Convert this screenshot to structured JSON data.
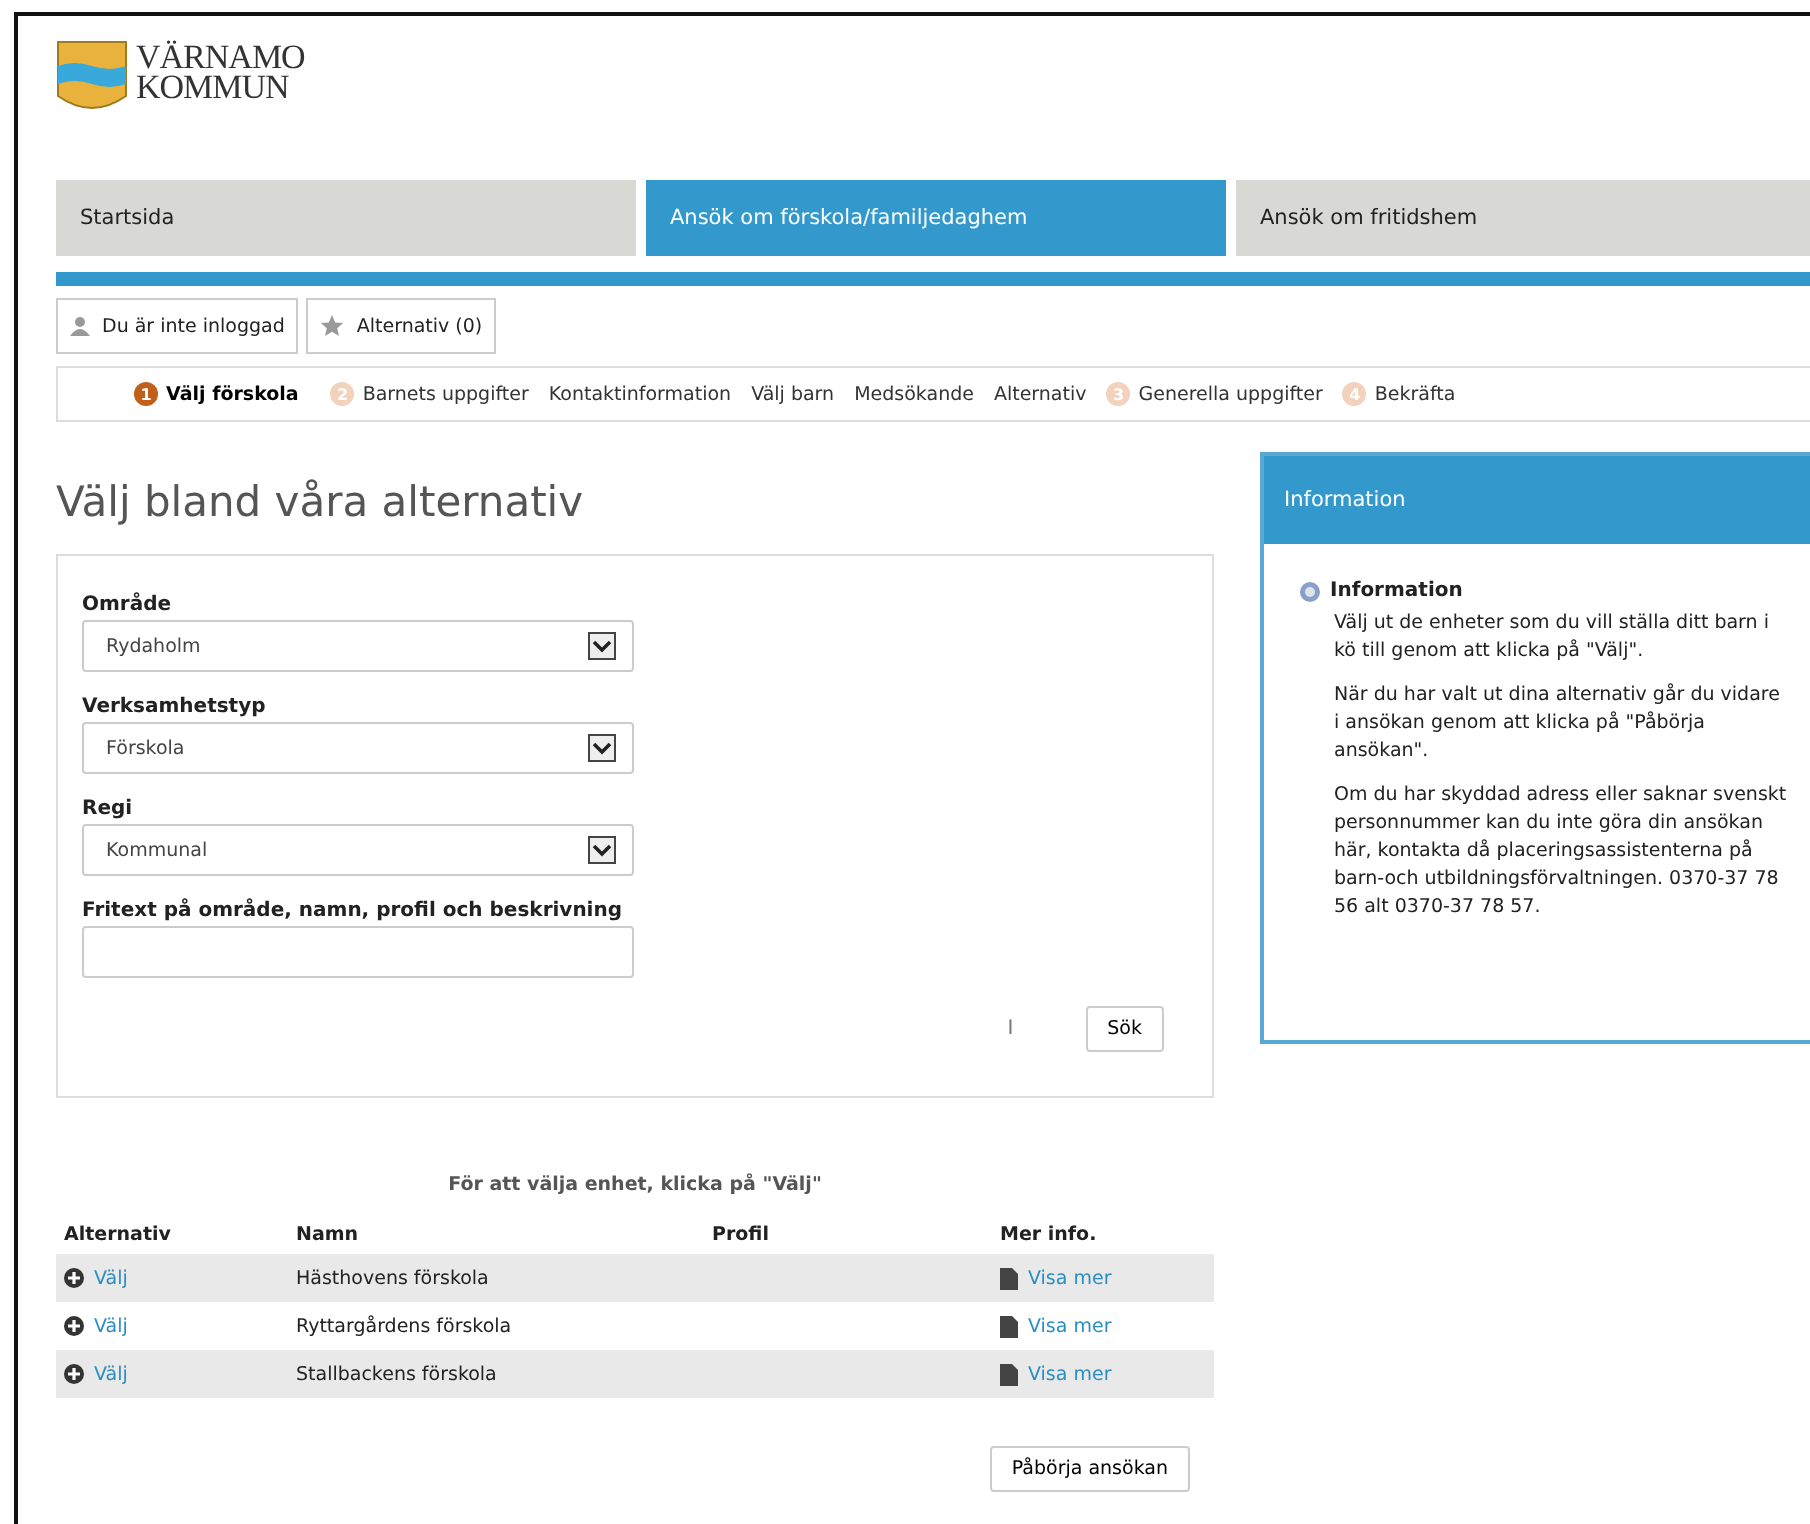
{
  "logo": {
    "line_1": "VÄRNAMO",
    "line_2": "KOMMUN"
  },
  "nav_tabs": [
    {
      "label": "Startsida",
      "selected": false
    },
    {
      "label": "Ansök om förskola/familjedaghem",
      "selected": true
    },
    {
      "label": "Ansök om fritidshem",
      "selected": false
    }
  ],
  "user_bar": [
    {
      "kind": "user",
      "label": "Du är inte inloggad"
    },
    {
      "kind": "star",
      "label": "Alternativ (0)"
    }
  ],
  "steps": [
    {
      "kind": "numbered",
      "number": "1",
      "label": "Välj förskola",
      "selected": true
    },
    {
      "kind": "numbered",
      "number": "2",
      "label": "Barnets uppgifter",
      "selected": false
    },
    {
      "kind": "plain",
      "label": "Kontaktinformation",
      "selected": false
    },
    {
      "kind": "plain",
      "label": "Välj barn",
      "selected": false
    },
    {
      "kind": "plain",
      "label": "Medsökande",
      "selected": false
    },
    {
      "kind": "plain",
      "label": "Alternativ",
      "selected": false
    },
    {
      "kind": "numbered",
      "number": "3",
      "label": "Generella uppgifter",
      "selected": false
    },
    {
      "kind": "numbered",
      "number": "4",
      "label": "Bekräfta",
      "selected": false
    }
  ],
  "heading": "Välj bland våra alternativ",
  "form": {
    "fields": [
      {
        "kind": "select",
        "label": "Område",
        "value": "Rydaholm"
      },
      {
        "kind": "select",
        "label": "Verksamhetstyp",
        "value": "Förskola"
      },
      {
        "kind": "select",
        "label": "Regi",
        "value": "Kommunal"
      },
      {
        "kind": "text",
        "label": "Fritext på område, namn, profil och beskrivning"
      }
    ],
    "marker": "I",
    "search_button": "Sök"
  },
  "info_panel": {
    "title": "Information",
    "heading": "Information",
    "paragraphs": [
      "Välj ut de enheter som du vill ställa ditt barn i kö till genom att klicka på \"Välj\".",
      "När du har valt ut dina alternativ går du vidare i ansökan genom att klicka på \"Påbörja ansökan\".",
      "Om du har skyddad adress eller saknar svenskt personnummer kan du inte göra din ansökan här, kontakta då placeringsassistenterna på barn-och utbildningsförvaltningen. 0370-37 78 56 alt 0370-37 78 57."
    ]
  },
  "table": {
    "caption": "För att välja enhet, klicka på \"Välj\"",
    "columns": [
      "Alternativ",
      "Namn",
      "Profil",
      "Mer info."
    ],
    "rows": [
      {
        "select": "Välj",
        "name": "Hästhovens förskola",
        "more": "Visa mer"
      },
      {
        "select": "Välj",
        "name": "Ryttargårdens förskola",
        "more": "Visa mer"
      },
      {
        "select": "Välj",
        "name": "Stallbackens förskola",
        "more": "Visa mer"
      }
    ]
  },
  "start_button": "Påbörja ansökan"
}
